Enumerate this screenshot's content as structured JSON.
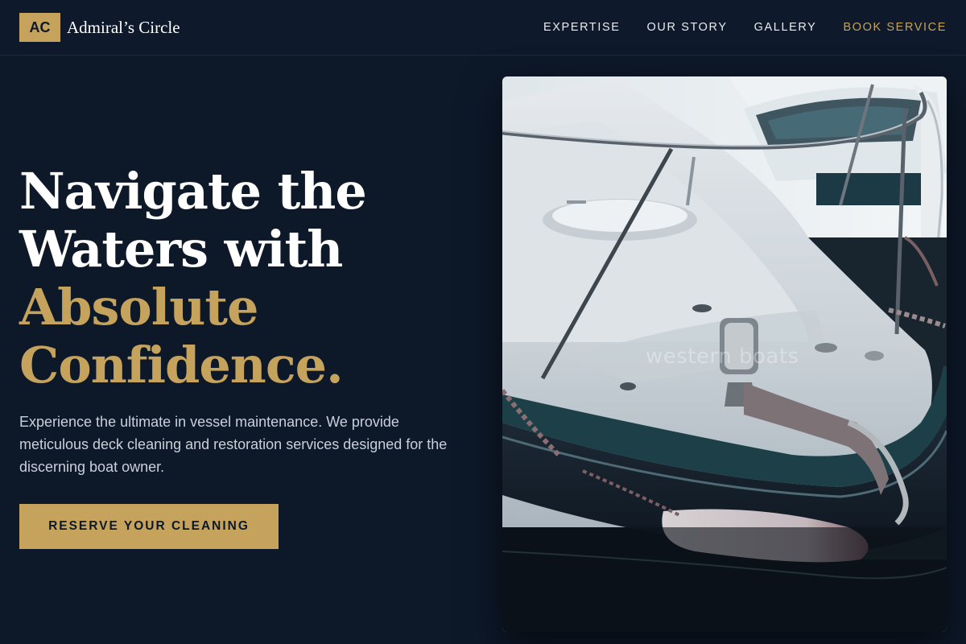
{
  "header": {
    "logo_initials": "AC",
    "brand_name": "Admiral’s Circle",
    "nav": [
      {
        "label": "EXPERTISE"
      },
      {
        "label": "OUR STORY"
      },
      {
        "label": "GALLERY"
      },
      {
        "label": "BOOK SERVICE",
        "accent": true
      }
    ]
  },
  "hero": {
    "headline": {
      "line1": "Navigate the",
      "line2": "Waters with",
      "line3": "Absolute",
      "line4": "Confidence."
    },
    "lede": "Experience the ultimate in vessel maintenance. We provide meticulous deck cleaning and restoration services designed for the discerning boat owner.",
    "cta_label": "RESERVE YOUR CLEANING"
  },
  "photo": {
    "watermark": "western boats",
    "subject": "boat-bow"
  },
  "colors": {
    "background": "#0d1829",
    "accent_gold": "#c5a35c",
    "text_white": "#ffffff",
    "text_muted": "#c9d0da"
  }
}
